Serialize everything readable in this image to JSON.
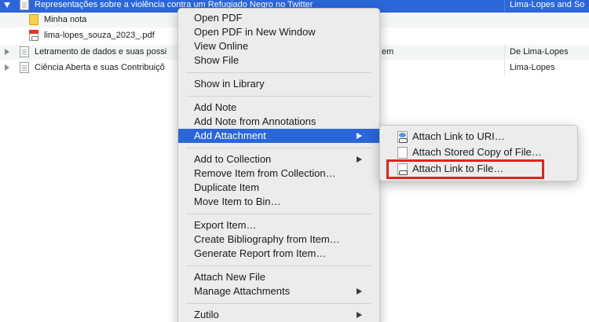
{
  "items": [
    {
      "title": "Representações sobre a violência contra um Refugiado Negro no Twitter",
      "creator": "Lima-Lopes and So",
      "expanded": true,
      "selected": true
    },
    {
      "title": "Minha nota",
      "type": "note"
    },
    {
      "title": "lima-lopes_souza_2023_.pdf",
      "type": "pdf"
    },
    {
      "title": "Letramento de dados e suas possi",
      "title_tail": "em",
      "creator": "De Lima-Lopes",
      "expanded": false
    },
    {
      "title": "Ciência Aberta e suas Contribuiçõ",
      "creator": "Lima-Lopes",
      "expanded": false
    }
  ],
  "context_menu": {
    "open_pdf": "Open PDF",
    "open_pdf_new_window": "Open PDF in New Window",
    "view_online": "View Online",
    "show_file": "Show File",
    "show_in_library": "Show in Library",
    "add_note": "Add Note",
    "add_note_from_annotations": "Add Note from Annotations",
    "add_attachment": "Add Attachment",
    "add_to_collection": "Add to Collection",
    "remove_from_collection": "Remove Item from Collection…",
    "duplicate_item": "Duplicate Item",
    "move_to_bin": "Move Item to Bin…",
    "export_item": "Export Item…",
    "create_bibliography": "Create Bibliography from Item…",
    "generate_report": "Generate Report from Item…",
    "attach_new_file": "Attach New File",
    "manage_attachments": "Manage Attachments",
    "zutilo": "Zutilo"
  },
  "attachment_submenu": {
    "attach_link_to_uri": "Attach Link to URI…",
    "attach_stored_copy": "Attach Stored Copy of File…",
    "attach_link_to_file": "Attach Link to File…"
  },
  "colors": {
    "selection": "#2b66d8",
    "highlight_box": "#e0241b"
  }
}
